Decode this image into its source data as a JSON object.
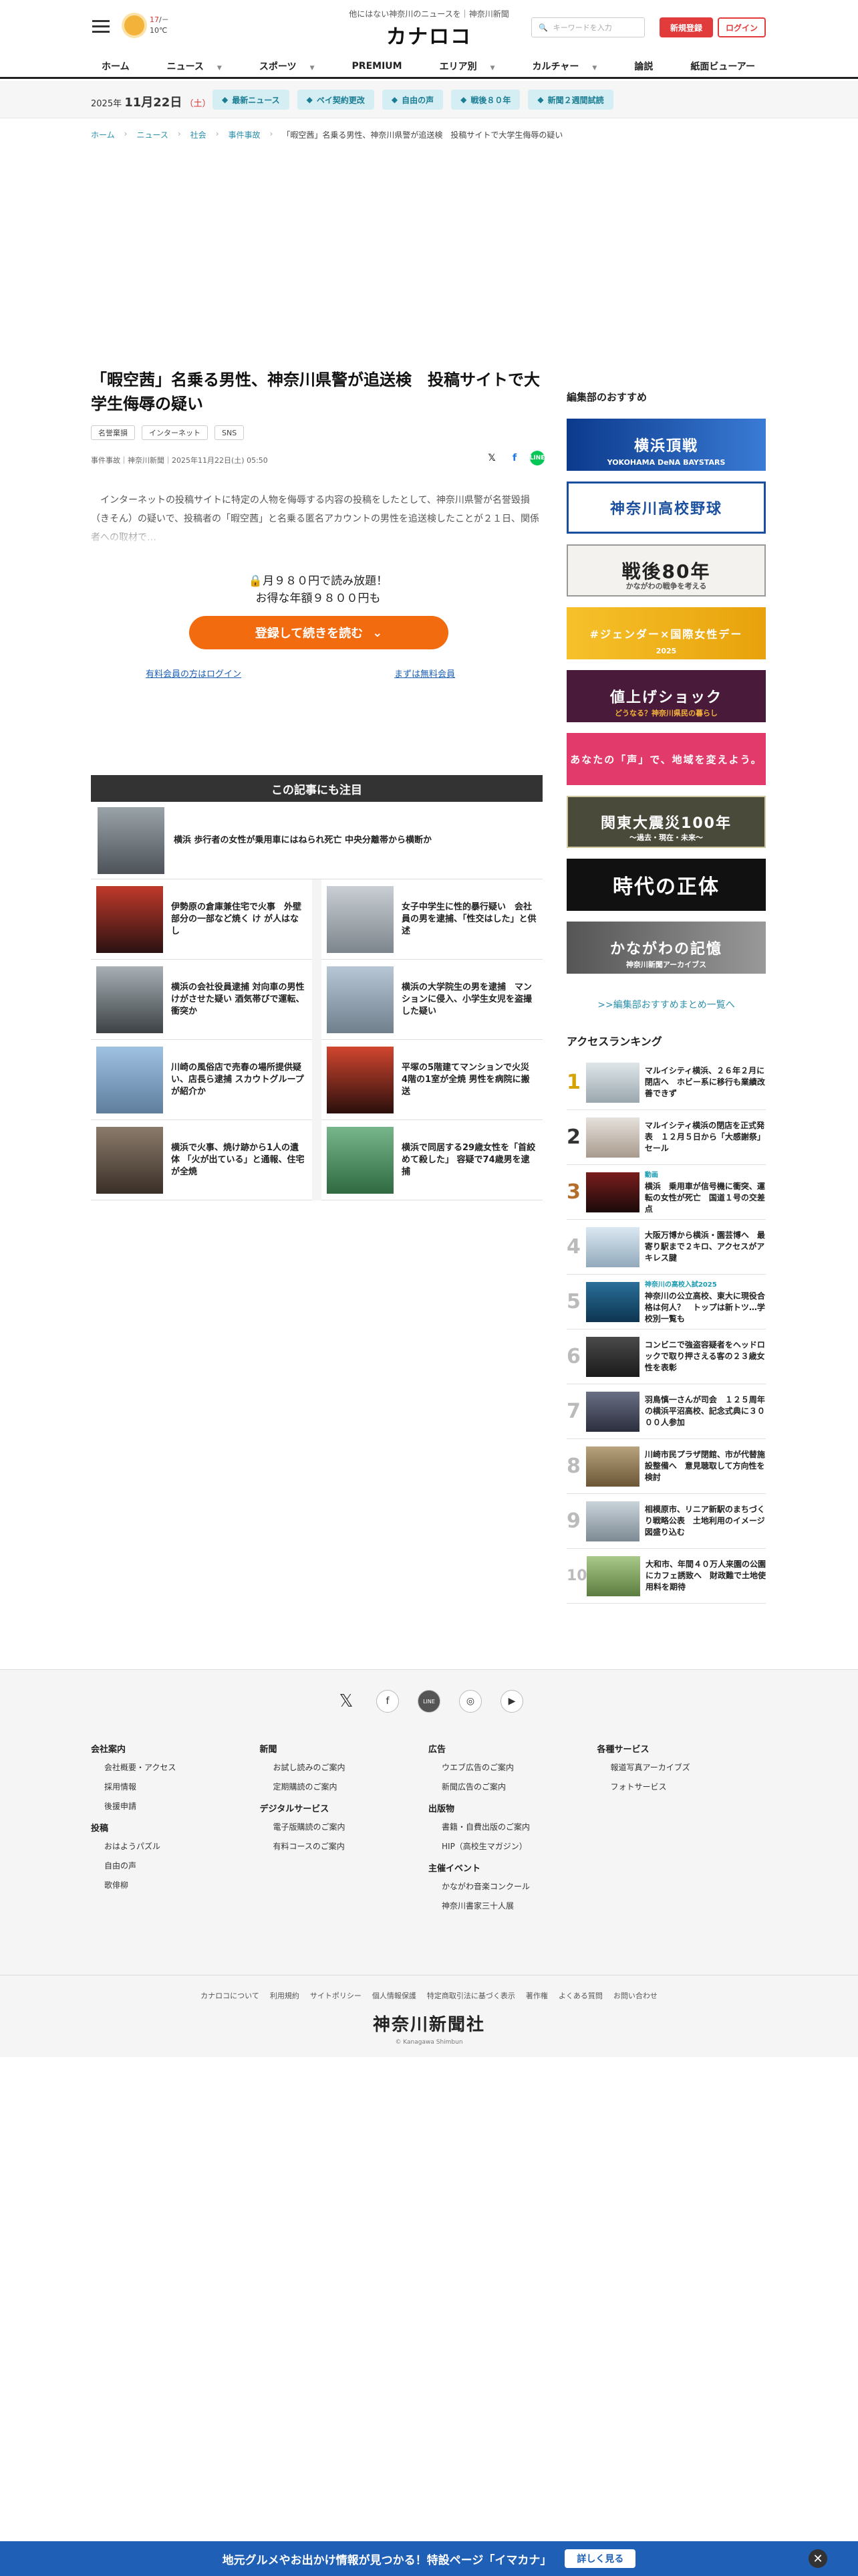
{
  "header": {
    "tagline": "他にはない神奈川のニュースを｜神奈川新聞",
    "logo": "カナロコ",
    "weather": {
      "hi": "17",
      "slash": "/－",
      "lo": "10",
      "unit": "℃"
    },
    "search_placeholder": "キーワードを入力",
    "register": "新規登録",
    "login": "ログイン",
    "nav": [
      "ホーム",
      "ニュース",
      "スポーツ",
      "PREMIUM",
      "エリア別",
      "カルチャー",
      "論説",
      "紙面ビューアー"
    ]
  },
  "subbar": {
    "year": "2025年",
    "day": "11月22日",
    "weekday": "（土）",
    "pills": [
      "最新ニュース",
      "ペイ契約更改",
      "自由の声",
      "戦後８０年",
      "新聞２週間試読"
    ]
  },
  "breadcrumbs": [
    "ホーム",
    "ニュース",
    "社会",
    "事件事故",
    "「暇空茜」名乗る男性、神奈川県警が追送検　投稿サイトで大学生侮辱の疑い"
  ],
  "article": {
    "title": "「暇空茜」名乗る男性、神奈川県警が追送検　投稿サイトで大学生侮辱の疑い",
    "tags": [
      "名誉棄損",
      "インターネット",
      "SNS"
    ],
    "meta": "事件事故｜神奈川新聞｜2025年11月22日(土) 05:50",
    "lead": "　インターネットの投稿サイトに特定の人物を侮辱する内容の投稿をしたとして、神奈川県警が名誉毀損（きそん）の疑いで、投稿者の「暇空茜」と名乗る匿名アカウントの男性を追送検したことが２１日、関係者への取材で…",
    "pay_line1": "月９８０円で読み放題！",
    "pay_line2": "お得な年額９８００円も",
    "cta": "登録して続きを読む",
    "login_link": "有料会員の方はログイン",
    "free_link": "まずは無料会員"
  },
  "related": {
    "heading": "この記事にも注目",
    "top": "横浜 歩行者の女性が乗用車にはねられ死亡 中央分離帯から横断か",
    "items": [
      "伊勢原の倉庫兼住宅で火事　外壁部分の一部など焼く け が人はなし",
      "女子中学生に性的暴行疑い　会社員の男を逮捕、「性交はした」と供述",
      "横浜の会社役員逮捕 対向車の男性けがさせた疑い 酒気帯びで運転、衝突か",
      "横浜の大学院生の男を逮捕　マンションに侵入、小学生女児を盗撮した疑い",
      "川崎の風俗店で売春の場所提供疑い、店長ら逮捕 スカウトグループが紹介か",
      "平塚の5階建てマンションで火災 4階の1室が全焼 男性を病院に搬送",
      "横浜で火事、焼け跡から1人の遺体 「火が出ている」と通報、住宅が全焼",
      "横浜で同居する29歳女性を「首絞めて殺した」 容疑で74歳男を逮捕"
    ]
  },
  "sidebar": {
    "title": "編集部のおすすめ",
    "banners": [
      {
        "text": "横浜頂戦",
        "sub": "YOKOHAMA DeNA BAYSTARS"
      },
      {
        "text": "神奈川高校野球",
        "sub": ""
      },
      {
        "text": "戦後80年",
        "sub": "かながわの戦争を考える"
      },
      {
        "text": "#ジェンダー×国際女性デー",
        "sub": "2025"
      },
      {
        "text": "値上げショック",
        "sub": "どうなる？神奈川県民の暮らし"
      },
      {
        "text": "あなたの「声」で、地域を変えよう。",
        "sub": ""
      },
      {
        "text": "関東大震災100年",
        "sub": "～過去・現在・未来～"
      },
      {
        "text": "時代の正体",
        "sub": ""
      },
      {
        "text": "かながわの記憶",
        "sub": "神奈川新聞アーカイブス"
      }
    ],
    "more": ">>編集部おすすめまとめ一覧へ",
    "rank_title": "アクセスランキング",
    "ranking": [
      {
        "n": "1",
        "badge": "",
        "text": "マルイシティ横浜、２６年２月に閉店へ　ホビー系に移行も業績改善できず"
      },
      {
        "n": "2",
        "badge": "",
        "text": "マルイシティ横浜の閉店を正式発表　１２月５日から「大感謝祭」セール"
      },
      {
        "n": "3",
        "badge": "動画",
        "text": "横浜　乗用車が信号機に衝突、運転の女性が死亡　国道１号の交差点"
      },
      {
        "n": "4",
        "badge": "",
        "text": "大阪万博から横浜・園芸博へ　最寄り駅まで２キロ、アクセスがアキレス腱"
      },
      {
        "n": "5",
        "badge": "神奈川の高校入試2025",
        "text": "神奈川の公立高校、東大に現役合格は何人？　トップは新トツ…学校別一覧も"
      },
      {
        "n": "6",
        "badge": "",
        "text": "コンビニで強盗容疑者をヘッドロックで取り押さえる客の２３歳女性を表彰"
      },
      {
        "n": "7",
        "badge": "",
        "text": "羽鳥慎一さんが司会　１２５周年の横浜平沼高校、記念式典に３０００人参加"
      },
      {
        "n": "8",
        "badge": "",
        "text": "川崎市民プラザ閉館、市が代替施設整備へ　意見聴取して方向性を検討"
      },
      {
        "n": "9",
        "badge": "",
        "text": "相模原市、リニア新駅のまちづくり戦略公表　土地利用のイメージ図盛り込む"
      },
      {
        "n": "10",
        "badge": "",
        "text": "大和市、年間４０万人来園の公園にカフェ誘致へ　財政難で土地使用料を期待"
      }
    ]
  },
  "footer": {
    "cols": [
      [
        {
          "head": "会社案内",
          "links": [
            "会社概要・アクセス",
            "採用情報",
            "後援申請"
          ]
        },
        {
          "head": "投稿",
          "links": [
            "おはようパズル",
            "自由の声",
            "歌俳柳"
          ]
        }
      ],
      [
        {
          "head": "新聞",
          "links": [
            "お試し読みのご案内",
            "定期購読のご案内"
          ]
        },
        {
          "head": "デジタルサービス",
          "links": [
            "電子版購読のご案内",
            "有料コースのご案内"
          ]
        }
      ],
      [
        {
          "head": "広告",
          "links": [
            "ウエブ広告のご案内",
            "新聞広告のご案内"
          ]
        },
        {
          "head": "出版物",
          "links": [
            "書籍・自費出版のご案内",
            "HIP（高校生マガジン）"
          ]
        },
        {
          "head": "主催イベント",
          "links": [
            "かながわ音楽コンクール",
            "神奈川書家三十人展"
          ]
        }
      ],
      [
        {
          "head": "各種サービス",
          "links": [
            "報道写真アーカイブズ",
            "フォトサービス"
          ]
        }
      ]
    ],
    "bottom_links": [
      "カナロコについて",
      "利用規約",
      "サイトポリシー",
      "個人情報保護",
      "特定商取引法に基づく表示",
      "著作権",
      "よくある質問",
      "お問い合わせ"
    ],
    "brand": "神奈川新聞社",
    "copyright": "© Kanagawa Shimbun"
  },
  "sticky": {
    "text": "地元グルメやお出かけ情報が見つかる！特設ページ「イマカナ」",
    "button": "詳しく見る"
  },
  "colors": {
    "accent": "#e23b3b",
    "cta": "#f26b0f",
    "link": "#2a8fab",
    "sticky": "#1f5fb5"
  }
}
